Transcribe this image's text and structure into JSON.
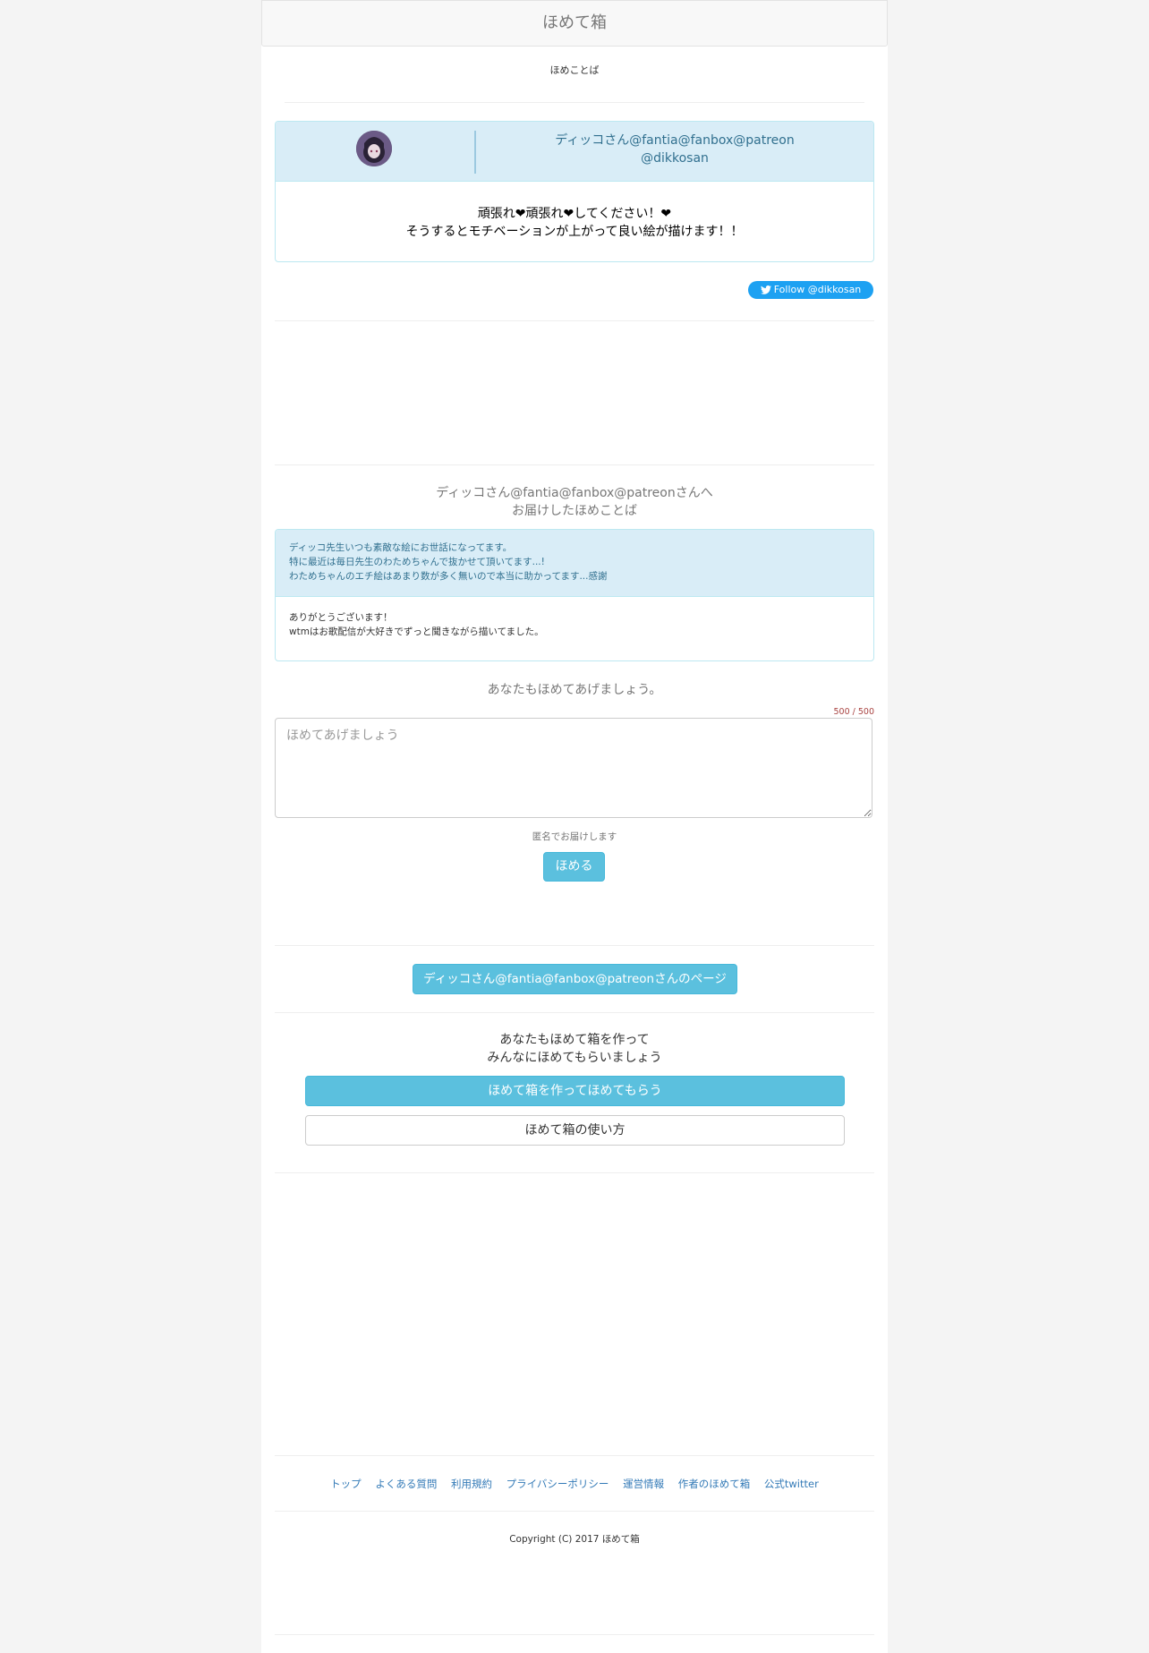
{
  "navbar": {
    "title": "ほめて箱"
  },
  "section_label": "ほめことば",
  "profile": {
    "name_line1": "ディッコさん@fantia@fanbox@patreon",
    "name_line2": "@dikkosan",
    "message_line1": "頑張れ❤頑張れ❤してください！❤",
    "message_line2": "そうするとモチベーションが上がって良い絵が描けます！！"
  },
  "twitter_follow": {
    "label": "Follow @dikkosan",
    "icon": "twitter-bird-icon"
  },
  "delivered": {
    "heading_line1": "ディッコさん@fantia@fanbox@patreonさんへ",
    "heading_line2": "お届けしたほめことば",
    "praise_lines": [
      "ディッコ先生いつも素敵な絵にお世話になってます。",
      "特に最近は毎日先生のわためちゃんで抜かせて頂いてます...!",
      "わためちゃんのエチ絵はあまり数が多く無いので本当に助かってます...感謝"
    ],
    "reply_lines": [
      "ありがとうございます！",
      "wtmはお歌配信が大好きでずっと聞きながら描いてました。"
    ]
  },
  "compose": {
    "heading": "あなたもほめてあげましょう。",
    "counter": "500 / 500",
    "placeholder": "ほめてあげましょう",
    "anonymous_note": "匿名でお届けします",
    "submit_label": "ほめる"
  },
  "author_page_button": "ディッコさん@fantia@fanbox@patreonさんのページ",
  "create_box": {
    "heading_line1": "あなたもほめて箱を作って",
    "heading_line2": "みんなにほめてもらいましょう",
    "create_button": "ほめて箱を作ってほめてもらう",
    "howto_button": "ほめて箱の使い方"
  },
  "footer": {
    "links": [
      "トップ",
      "よくある質問",
      "利用規約",
      "プライバシーポリシー",
      "運営情報",
      "作者のほめて箱",
      "公式twitter"
    ],
    "copyright": "Copyright (C) 2017 ほめて箱"
  },
  "colors": {
    "info_bg": "#d9edf7",
    "info_border": "#bce8f1",
    "info_text": "#31708f",
    "btn_info": "#5bc0de",
    "twitter_blue": "#1da1f2",
    "link": "#337ab7",
    "counter_red": "#a94442"
  }
}
